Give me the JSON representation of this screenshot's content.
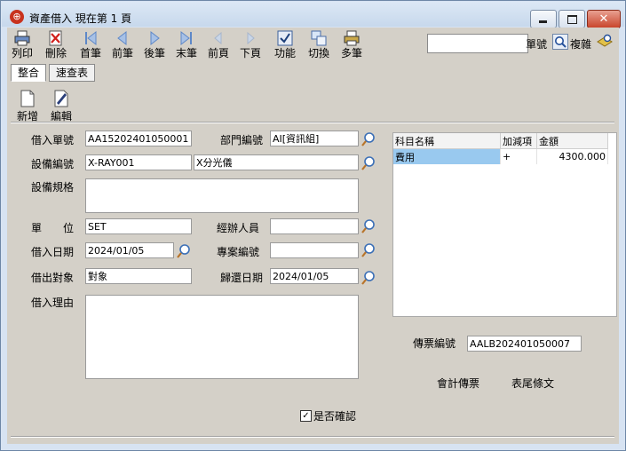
{
  "window": {
    "title": "資產借入  現在第 1 頁"
  },
  "toolbar": {
    "items": [
      {
        "label": "列印",
        "icon": "printer-icon"
      },
      {
        "label": "刪除",
        "icon": "delete-icon"
      },
      {
        "label": "首筆",
        "icon": "first-record-icon"
      },
      {
        "label": "前筆",
        "icon": "previous-record-icon"
      },
      {
        "label": "後筆",
        "icon": "next-record-icon"
      },
      {
        "label": "末筆",
        "icon": "last-record-icon"
      },
      {
        "label": "前頁",
        "icon": "previous-page-icon"
      },
      {
        "label": "下頁",
        "icon": "next-page-icon"
      },
      {
        "label": "功能",
        "icon": "function-icon"
      },
      {
        "label": "切換",
        "icon": "switch-icon"
      },
      {
        "label": "多筆",
        "icon": "multi-record-icon"
      }
    ],
    "search_label": "單號",
    "complex_label": "複雜"
  },
  "tabs": [
    {
      "label": "整合"
    },
    {
      "label": "速查表"
    }
  ],
  "subtoolbar": {
    "new_label": "新增",
    "edit_label": "編輯"
  },
  "form": {
    "borrow_no_label": "借入單號",
    "borrow_no": "AA15202401050001",
    "dept_label": "部門編號",
    "dept": "AI[資訊組]",
    "equip_no_label": "設備編號",
    "equip_no": "X-RAY001",
    "equip_name": "X分光儀",
    "spec_label": "設備規格",
    "spec": "",
    "unit_label": "單　　位",
    "unit": "SET",
    "handler_label": "經辦人員",
    "handler": "",
    "borrow_date_label": "借入日期",
    "borrow_date": "2024/01/05",
    "project_label": "專案編號",
    "project": "",
    "lender_label": "借出對象",
    "lender": "對象",
    "return_date_label": "歸還日期",
    "return_date": "2024/01/05",
    "reason_label": "借入理由",
    "reason": ""
  },
  "grid": {
    "headers": [
      "科目名稱",
      "加減項",
      "金額"
    ],
    "rows": [
      {
        "name": "費用",
        "sign": "+",
        "amount": "4300.000"
      }
    ]
  },
  "voucher": {
    "label": "傳票編號",
    "value": "AALB202401050007"
  },
  "links": {
    "acct_voucher": "會計傳票",
    "tail_text": "表尾條文"
  },
  "confirm": {
    "label": "是否確認",
    "checked": "✓"
  },
  "colors": {
    "title_bg": "#d7e3f2",
    "client_bg": "#d4d0c8",
    "selection": "#99c9ef"
  }
}
